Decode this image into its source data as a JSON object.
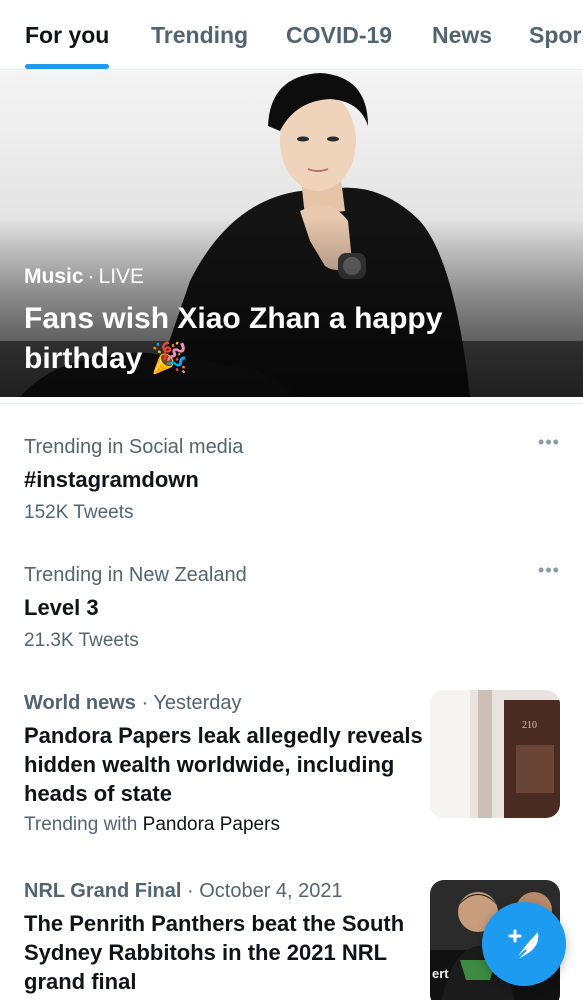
{
  "tabs": [
    {
      "label": "For you",
      "active": true
    },
    {
      "label": "Trending",
      "active": false
    },
    {
      "label": "COVID-19",
      "active": false
    },
    {
      "label": "News",
      "active": false
    },
    {
      "label": "Spor",
      "active": false
    }
  ],
  "hero": {
    "category": "Music",
    "status": "LIVE",
    "title": "Fans wish Xiao Zhan a happy birthday",
    "emoji": "🎉"
  },
  "trends": [
    {
      "context": "Trending in Social media",
      "name": "#instagramdown",
      "count": "152K Tweets",
      "more_icon": "more-icon"
    },
    {
      "context": "Trending in New Zealand",
      "name": "Level 3",
      "count": "21.3K Tweets",
      "more_icon": "more-icon"
    }
  ],
  "news": [
    {
      "source": "World news",
      "time": "Yesterday",
      "title": "Pandora Papers leak allegedly reveals hidden wealth worldwide, including heads of state",
      "sub_prefix": "Trending with",
      "sub_name": "Pandora Papers",
      "thumb_text": "210"
    },
    {
      "source": "NRL Grand Final",
      "time": "October 4, 2021",
      "title": "The Penrith Panthers beat the South Sydney Rabbitohs in the 2021 NRL grand final",
      "thumb_text": "ert"
    }
  ],
  "fab": {
    "icon": "compose-icon"
  },
  "separator": "·",
  "colors": {
    "accent": "#1d9bf0",
    "text": "#0f1419",
    "secondary": "#536471"
  }
}
